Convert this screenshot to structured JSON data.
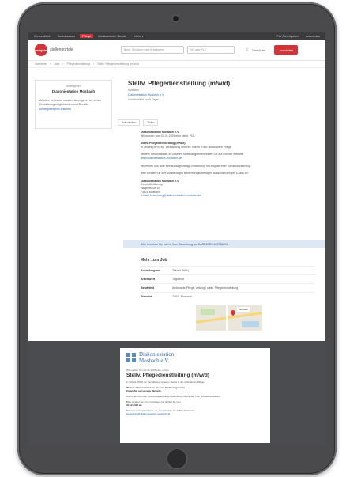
{
  "topbar": {
    "tabs": [
      "Gesundheit",
      "Sozialwesen",
      "Pflege",
      "Medizinische Berufe",
      "Mehr ▾"
    ],
    "active_index": 2,
    "right_links": [
      "Für Arbeitgeber",
      "Anmelden"
    ]
  },
  "header": {
    "logo_text": "carejobs",
    "brand": "stellenportale",
    "search_placeholder": "Beruf, Stichwort oder Arbeitgeber",
    "location_placeholder": "Ort oder PLZ",
    "merkliste_label": "Merkliste",
    "cta_label": "Anmelden"
  },
  "breadcrumbs": [
    "Startseite",
    "Jobs",
    "Pflegedienstleitung",
    "Stellv. Pflegedienstleitung (m/w/d)"
  ],
  "employer_card": {
    "overline": "Arbeitgeber",
    "name": "Diakoniestation Mosbach",
    "text": "Arbeiten bei einem sozialen Arbeitgeber mit vielen Entwicklungsmöglichkeiten und Benefits.",
    "link": "Arbeitgeberprofil ansehen"
  },
  "job": {
    "title": "Stellv. Pflegedienstleitung (m/w/d)",
    "location": "Mosbach",
    "employer_link": "Diakoniestation Mosbach e.V.",
    "posted": "Veröffentlicht vor 5 Tagen"
  },
  "actions": {
    "save": "Job merken",
    "share": "Teilen"
  },
  "description": [
    {
      "text": "Diakoniestation Mosbach e.V.",
      "style": "b"
    },
    {
      "text": "Wir suchen zum 01.01.2025 eine stellv. PDL.",
      "style": ""
    },
    {
      "text": "",
      "style": "gap"
    },
    {
      "text": "Stellv. Pflegedienstleitung (m/w/d)",
      "style": "b"
    },
    {
      "text": "in Teilzeit (50%) zur Verstärkung unseres Teams in der ambulanten Pflege.",
      "style": ""
    },
    {
      "text": "",
      "style": "gap"
    },
    {
      "text": "Weitere Informationen zu unseren Stellenangeboten finden Sie auf unserer Website:",
      "style": ""
    },
    {
      "text": "www.diakoniestation-mosbach.de",
      "style": "l"
    },
    {
      "text": "",
      "style": "gap"
    },
    {
      "text": "Wir freuen uns über Ihre aussagekräftige Bewerbung mit Angabe Ihrer Gehaltsvorstellung.",
      "style": ""
    },
    {
      "text": "",
      "style": "gap"
    },
    {
      "text": "Bitte senden Sie Ihre vollständigen Bewerbungsunterlagen ausschließlich per E-Mail an:",
      "style": ""
    },
    {
      "text": "",
      "style": "gap"
    },
    {
      "text": "Diakoniestation Mosbach e.V.",
      "style": "b"
    },
    {
      "text": "Geschäftsführung",
      "style": ""
    },
    {
      "text": "Hauptstraße 10",
      "style": ""
    },
    {
      "text": "74821 Mosbach",
      "style": ""
    },
    {
      "text": "E-Mail: bewerbung@diakoniestation-mosbach.de",
      "style": "l"
    }
  ],
  "notice": "Bitte beziehen Sie sich in Ihrer Bewerbung auf CAREJOBS.MOSBACH.",
  "details": {
    "heading": "Mehr zum Job",
    "rows": [
      {
        "key": "Anstellungsart",
        "value": "Teilzeit (50%)"
      },
      {
        "key": "Arbeitszeit",
        "value": "Tagdienst"
      },
      {
        "key": "Berufsfeld",
        "value": "Ambulante Pflege, Leitung / stellv. Pflegedienstleitung"
      },
      {
        "key": "Standort",
        "value": "74821 Mosbach"
      }
    ],
    "map_label": "Mosbach"
  },
  "print": {
    "org_line1": "Diakoniestation",
    "org_line2": "Mosbach e.V.",
    "intro": "Wir suchen zum 01.01.2025 eine / einen",
    "title": "Stellv. Pflegedienstleitung (m/w/d)",
    "lines": [
      {
        "text": "in Teilzeit (50%) zur Verstärkung unseres Teams in der ambulanten Pflege.",
        "style": ""
      },
      {
        "text": "",
        "style": "gap"
      },
      {
        "text": "Weitere Informationen zu unseren Stellenangeboten",
        "style": "b"
      },
      {
        "text": "finden Sie auf unserer Website.",
        "style": "b"
      },
      {
        "text": "",
        "style": "gap"
      },
      {
        "text": "Wir freuen uns über Ihre aussagekräftige Bewerbung mit Angabe Ihrer Gehaltsvorstellung.",
        "style": ""
      },
      {
        "text": "",
        "style": "gap"
      },
      {
        "text": "Bitte senden Sie Ihre Unterlagen per E-Mail bis zum",
        "style": ""
      },
      {
        "text": "31.12.2024 an:",
        "style": "b"
      },
      {
        "text": "",
        "style": "gap"
      },
      {
        "text": "Diakoniestation Mosbach e.V., Hauptstraße 10, 74821 Mosbach",
        "style": ""
      },
      {
        "text": "bewerbung@diakoniestation-mosbach.de",
        "style": "l"
      }
    ]
  }
}
